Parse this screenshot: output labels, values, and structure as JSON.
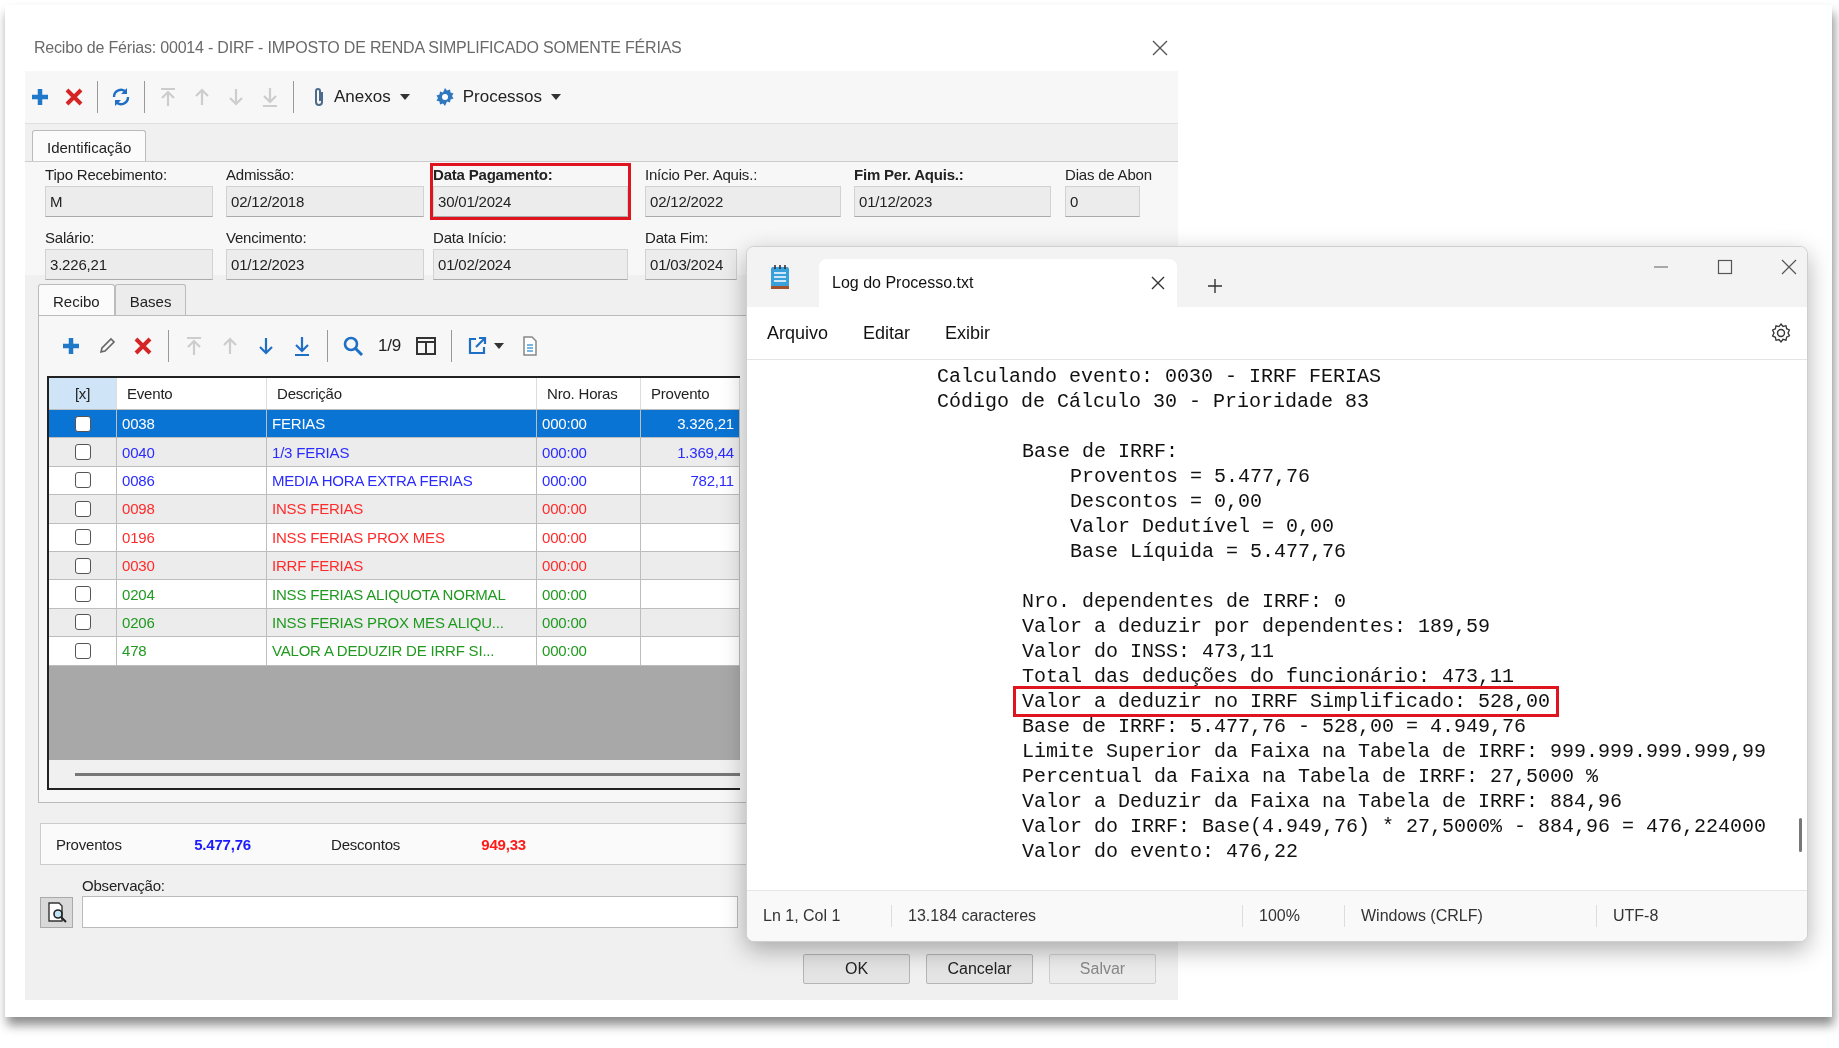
{
  "dialog": {
    "title": "Recibo de Férias: 00014 - DIRF - IMPOSTO DE RENDA SIMPLIFICADO SOMENTE FÉRIAS",
    "toolbar": [
      {
        "kind": "add",
        "disabled": false
      },
      {
        "kind": "delete",
        "disabled": false
      },
      {
        "kind": "separator"
      },
      {
        "kind": "refresh",
        "disabled": false
      },
      {
        "kind": "separator"
      },
      {
        "kind": "first",
        "disabled": true
      },
      {
        "kind": "previous",
        "disabled": true
      },
      {
        "kind": "next",
        "disabled": true
      },
      {
        "kind": "last",
        "disabled": true
      },
      {
        "kind": "separator"
      },
      {
        "kind": "attach",
        "label": "Anexos"
      },
      {
        "kind": "process",
        "label": "Processos"
      }
    ],
    "tabs": [
      {
        "label": "Identificação",
        "selected": true
      }
    ],
    "fields": [
      [
        {
          "label": "Tipo Recebimento:",
          "value": "M",
          "emphasized": false,
          "highlighted": false
        },
        {
          "label": "Admissão:",
          "value": "02/12/2018",
          "emphasized": false,
          "highlighted": false
        },
        {
          "label": "Data Pagamento:",
          "value": "30/01/2024",
          "emphasized": true,
          "highlighted": true
        },
        {
          "label": "Início Per. Aquis.:",
          "value": "02/12/2022",
          "emphasized": false,
          "highlighted": false
        },
        {
          "label": "Fim Per. Aquis.:",
          "value": "01/12/2023",
          "emphasized": true,
          "highlighted": false
        },
        {
          "label": "Dias de Abon",
          "value": "0",
          "emphasized": false,
          "highlighted": false
        }
      ],
      [
        {
          "label": "Salário:",
          "value": "3.226,21",
          "emphasized": false,
          "highlighted": false
        },
        {
          "label": "Vencimento:",
          "value": "01/12/2023",
          "emphasized": false,
          "highlighted": false
        },
        {
          "label": "Data Início:",
          "value": "01/02/2024",
          "emphasized": false,
          "highlighted": false
        },
        {
          "label": "Data Fim:",
          "value": "01/03/2024",
          "emphasized": false,
          "highlighted": false
        }
      ]
    ],
    "subtabs": [
      {
        "label": "Recibo",
        "selected": true
      },
      {
        "label": "Bases",
        "selected": false
      }
    ],
    "subtoolbar": [
      {
        "kind": "add",
        "disabled": false
      },
      {
        "kind": "edit",
        "disabled": false
      },
      {
        "kind": "delete",
        "disabled": false
      },
      {
        "kind": "separator"
      },
      {
        "kind": "first",
        "disabled": true
      },
      {
        "kind": "previous",
        "disabled": true
      },
      {
        "kind": "next",
        "disabled": false
      },
      {
        "kind": "last",
        "disabled": false
      },
      {
        "kind": "separator"
      },
      {
        "kind": "search",
        "disabled": false
      },
      {
        "kind": "counter",
        "label": "1/9"
      },
      {
        "kind": "columns",
        "disabled": false
      },
      {
        "kind": "separator"
      },
      {
        "kind": "export",
        "disabled": false
      },
      {
        "kind": "document",
        "disabled": false
      }
    ],
    "table": {
      "columns": [
        "[x]",
        "Evento",
        "Descrição",
        "Nro. Horas",
        "Provento"
      ],
      "rows": [
        {
          "checked": false,
          "selected": true,
          "event": "0038",
          "description": "FERIAS",
          "hours": "000:00",
          "amount": "3.326,21"
        },
        {
          "checked": false,
          "selected": false,
          "color": "#2b2bff",
          "event": "0040",
          "description": "1/3 FERIAS",
          "hours": "000:00",
          "amount": "1.369,44"
        },
        {
          "checked": false,
          "selected": false,
          "color": "#2b2bff",
          "event": "0086",
          "description": "MEDIA HORA EXTRA FERIAS",
          "hours": "000:00",
          "amount": "782,11"
        },
        {
          "checked": false,
          "selected": false,
          "color": "#ff2b2b",
          "event": "0098",
          "description": "INSS FERIAS",
          "hours": "000:00"
        },
        {
          "checked": false,
          "selected": false,
          "color": "#ff2b2b",
          "event": "0196",
          "description": "INSS FERIAS PROX MES",
          "hours": "000:00"
        },
        {
          "checked": false,
          "selected": false,
          "color": "#ff2b2b",
          "event": "0030",
          "description": "IRRF FERIAS",
          "hours": "000:00"
        },
        {
          "checked": false,
          "selected": false,
          "color": "#1f9a1f",
          "event": "0204",
          "description": "INSS FERIAS ALIQUOTA NORMAL",
          "hours": "000:00"
        },
        {
          "checked": false,
          "selected": false,
          "color": "#1f9a1f",
          "event": "0206",
          "description": "INSS FERIAS PROX MES ALIQU...",
          "hours": "000:00"
        },
        {
          "checked": false,
          "selected": false,
          "color": "#1f9a1f",
          "event": "478",
          "description": "VALOR A DEDUZIR DE IRRF SI...",
          "hours": "000:00"
        }
      ]
    },
    "totals": [
      {
        "label": "Proventos",
        "value": "5.477,76",
        "color": "#1a1aff"
      },
      {
        "label": "Descontos",
        "value": "949,33",
        "color": "#ff1a1a"
      }
    ],
    "observation": {
      "label": "Observação:"
    },
    "buttons": [
      {
        "label": "OK",
        "disabled": false
      },
      {
        "label": "Cancelar",
        "disabled": false
      },
      {
        "label": "Salvar",
        "disabled": true
      }
    ]
  },
  "notepad": {
    "tabs": [
      {
        "label": "Log do Processo.txt",
        "selected": true
      }
    ],
    "menu": [
      "Arquivo",
      "Editar",
      "Exibir"
    ],
    "lines": [
      {
        "text": "Calculando evento: 0030 - IRRF FERIAS"
      },
      {
        "text": "Código de Cálculo 30 - Prioridade 83",
        "children": [
          {
            "text": "Base de IRRF:",
            "highlighted": false,
            "children": [
              {
                "text": "Proventos = 5.477,76"
              },
              {
                "text": "Descontos = 0,00"
              },
              {
                "text": "Valor Dedutível = 0,00"
              },
              {
                "text": "Base Líquida = 5.477,76"
              }
            ]
          },
          {
            "text": "Nro. dependentes de IRRF: 0",
            "highlighted": false
          },
          {
            "text": "Valor a deduzir por dependentes: 189,59",
            "highlighted": false
          },
          {
            "text": "Valor do INSS: 473,11",
            "highlighted": false
          },
          {
            "text": "Total das deduções do funcionário: 473,11",
            "highlighted": false
          },
          {
            "text": "Valor a deduzir no IRRF Simplificado: 528,00",
            "highlighted": true
          },
          {
            "text": "Base de IRRF: 5.477,76 - 528,00 = 4.949,76",
            "highlighted": false
          },
          {
            "text": "Limite Superior da Faixa na Tabela de IRRF: 999.999.999.999,99",
            "highlighted": false
          },
          {
            "text": "Percentual da Faixa na Tabela de IRRF: 27,5000 %",
            "highlighted": false
          },
          {
            "text": "Valor a Deduzir da Faixa na Tabela de IRRF: 884,96",
            "highlighted": false
          },
          {
            "text": "Valor do IRRF: Base(4.949,76) * 27,5000% - 884,96 = 476,224000",
            "highlighted": false
          },
          {
            "text": "Valor do evento: 476,22",
            "highlighted": false
          }
        ]
      }
    ],
    "status": [
      "Ln 1, Col 1",
      "13.184 caracteres",
      "100%",
      "Windows (CRLF)",
      "UTF-8"
    ]
  }
}
